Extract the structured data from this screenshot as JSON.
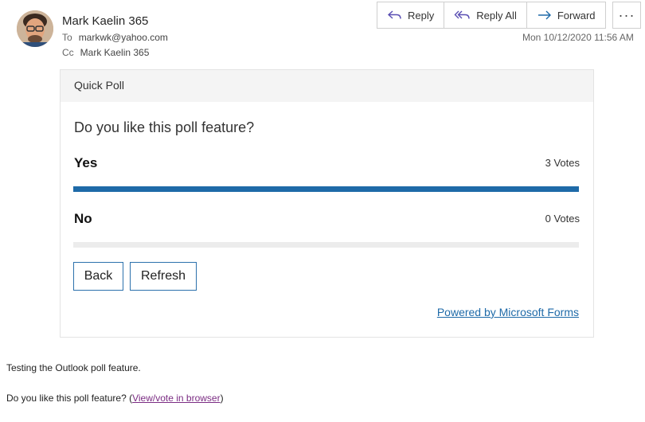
{
  "email": {
    "sender": "Mark Kaelin 365",
    "to_label": "To",
    "to_value": "markwk@yahoo.com",
    "cc_label": "Cc",
    "cc_value": "Mark Kaelin 365",
    "timestamp": "Mon 10/12/2020 11:56 AM"
  },
  "actions": {
    "reply": "Reply",
    "reply_all": "Reply All",
    "forward": "Forward",
    "more": "···"
  },
  "poll": {
    "header": "Quick Poll",
    "question": "Do you like this poll feature?",
    "options": [
      {
        "label": "Yes",
        "votes_text": "3 Votes",
        "fraction": 1.0
      },
      {
        "label": "No",
        "votes_text": "0 Votes",
        "fraction": 0.0
      }
    ],
    "back_label": "Back",
    "refresh_label": "Refresh",
    "powered_by": "Powered by Microsoft Forms",
    "accent_color": "#1e6aa8"
  },
  "body": {
    "line1": "Testing the Outlook poll feature.",
    "line2_prefix": "Do you like this poll feature? (",
    "line2_link": "View/vote in browser",
    "line2_suffix": ")"
  }
}
